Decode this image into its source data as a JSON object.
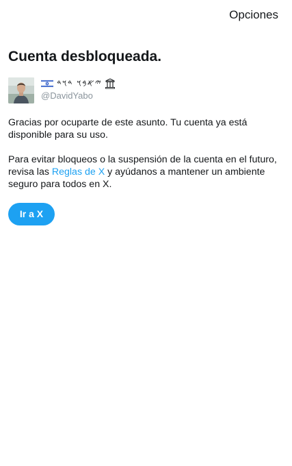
{
  "header": {
    "options_label": "Opciones"
  },
  "page": {
    "title": "Cuenta desbloqueada."
  },
  "account": {
    "display_name": "𐤃𐤅𐤃 𐤉𐤀𐤁𐤅",
    "display_name_shown": "𐤉𐤀𐤁𐤅 𐤃𐤅𐤃",
    "handle": "@DavidYabo",
    "name_prefix_icon": "israel-flag-icon",
    "name_suffix_icon": "temple-icon",
    "avatar_icon": "avatar"
  },
  "body": {
    "paragraph1": "Gracias por ocuparte de este asunto. Tu cuenta ya está disponible para su uso.",
    "paragraph2_before": "Para evitar bloqueos o la suspensión de la cuenta en el futuro, revisa las ",
    "paragraph2_link": "Reglas de X",
    "paragraph2_after": " y ayúdanos a mantener un ambiente seguro para todos en X."
  },
  "actions": {
    "go_button_label": "Ir a X"
  },
  "colors": {
    "accent": "#1da1f2",
    "text": "#14171a",
    "secondary_text": "#8a949c",
    "background": "#ffffff"
  }
}
